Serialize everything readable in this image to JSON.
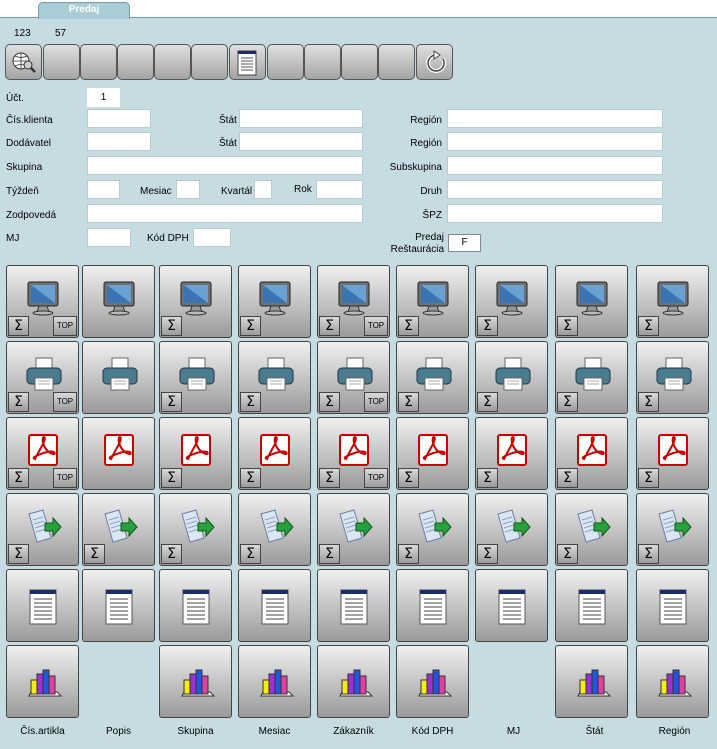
{
  "tab": {
    "label": "Predaj"
  },
  "counters": [
    "123",
    "57"
  ],
  "form": {
    "ucty_label": "Účt.",
    "ucty_value": "1",
    "cis_klienta": "Čís.klienta",
    "dodavatel": "Dodávatel",
    "skupina": "Skupina",
    "tyzden": "Týždeň",
    "mesiac": "Mesiac",
    "kvartal": "Kvartál",
    "rok": "Rok",
    "zodpoveda": "Zodpovedá",
    "mj": "MJ",
    "kod_dph": "Kód DPH",
    "stat1": "Štát",
    "stat2": "Štát",
    "region1": "Región",
    "region2": "Región",
    "subskupina": "Subskupina",
    "druh": "Druh",
    "spz": "ŠPZ",
    "predaj": "Predaj",
    "restauracia": "Reštaurácia",
    "restauracia_value": "F"
  },
  "grid": {
    "sigma": "Σ",
    "top": "TOP",
    "rows": [
      "monitor-icon",
      "printer-icon",
      "pdf-icon",
      "export-icon",
      "document-icon",
      "chart-icon"
    ]
  },
  "columns": [
    "Čís.artikla",
    "Popis",
    "Skupina",
    "Mesiac",
    "Zákazník",
    "Kód DPH",
    "MJ",
    "Štát",
    "Región"
  ]
}
